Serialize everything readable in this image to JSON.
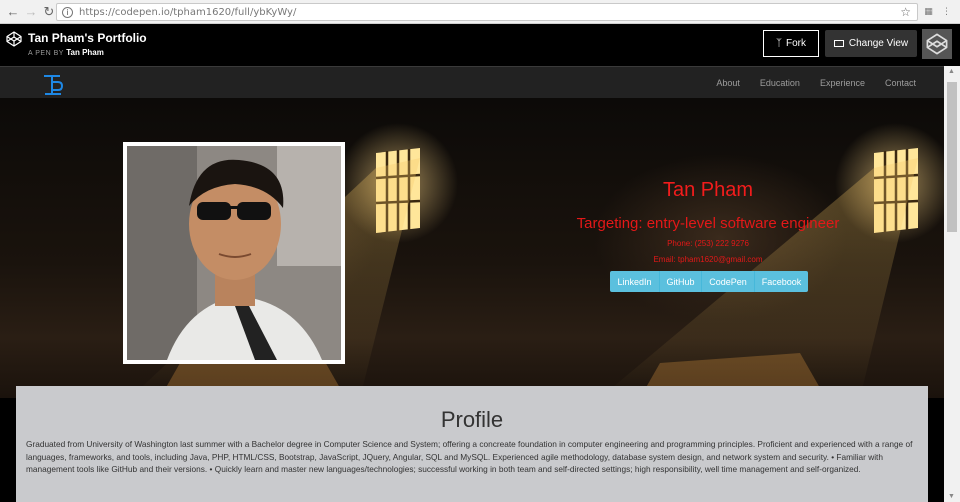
{
  "browser": {
    "url": "https://codepen.io/tpham1620/full/ybKyWy/"
  },
  "codepen": {
    "title": "Tan Pham's Portfolio",
    "byline_prefix": "A PEN BY",
    "author": "Tan Pham",
    "fork_label": "Fork",
    "change_view_label": "Change View"
  },
  "navbar": {
    "brand": "TP",
    "links": [
      {
        "label": "About"
      },
      {
        "label": "Education"
      },
      {
        "label": "Experience"
      },
      {
        "label": "Contact"
      }
    ]
  },
  "hero": {
    "name": "Tan Pham",
    "target": "Targeting: entry-level software engineer",
    "phone": "Phone: (253) 222 9276",
    "email": "Email: tpham1620@gmail.com",
    "buttons": [
      {
        "label": "LinkedIn"
      },
      {
        "label": "GitHub"
      },
      {
        "label": "CodePen"
      },
      {
        "label": "Facebook"
      }
    ]
  },
  "profile": {
    "title": "Profile",
    "text": "Graduated from University of Washington last summer with a Bachelor degree in Computer Science and System; offering a concreate foundation in computer engineering and programming principles. Proficient and experienced with a range of languages, frameworks, and tools, including Java, PHP, HTML/CSS, Bootstrap, JavaScript, JQuery, Angular, SQL and MySQL. Experienced agile methodology, database system design, and network system and security. • Familiar with management tools like GitHub and their versions. • Quickly learn and master new languages/technologies; successful working in both team and self-directed settings; high responsibility, well time management and self-organized."
  },
  "colors": {
    "accent_red": "#e31818",
    "button_info": "#5bc0de",
    "navbar_bg": "#222222",
    "profile_bg": "#c9cacd",
    "brand_blue": "#1e88e5"
  },
  "icons": {
    "back": "arrow-left",
    "forward": "arrow-right",
    "reload": "reload",
    "info": "info-circle",
    "bookmark": "star",
    "codepen_logo": "codepen-cube",
    "fork": "fork",
    "change_view": "window",
    "avatar": "codepen-cube"
  }
}
